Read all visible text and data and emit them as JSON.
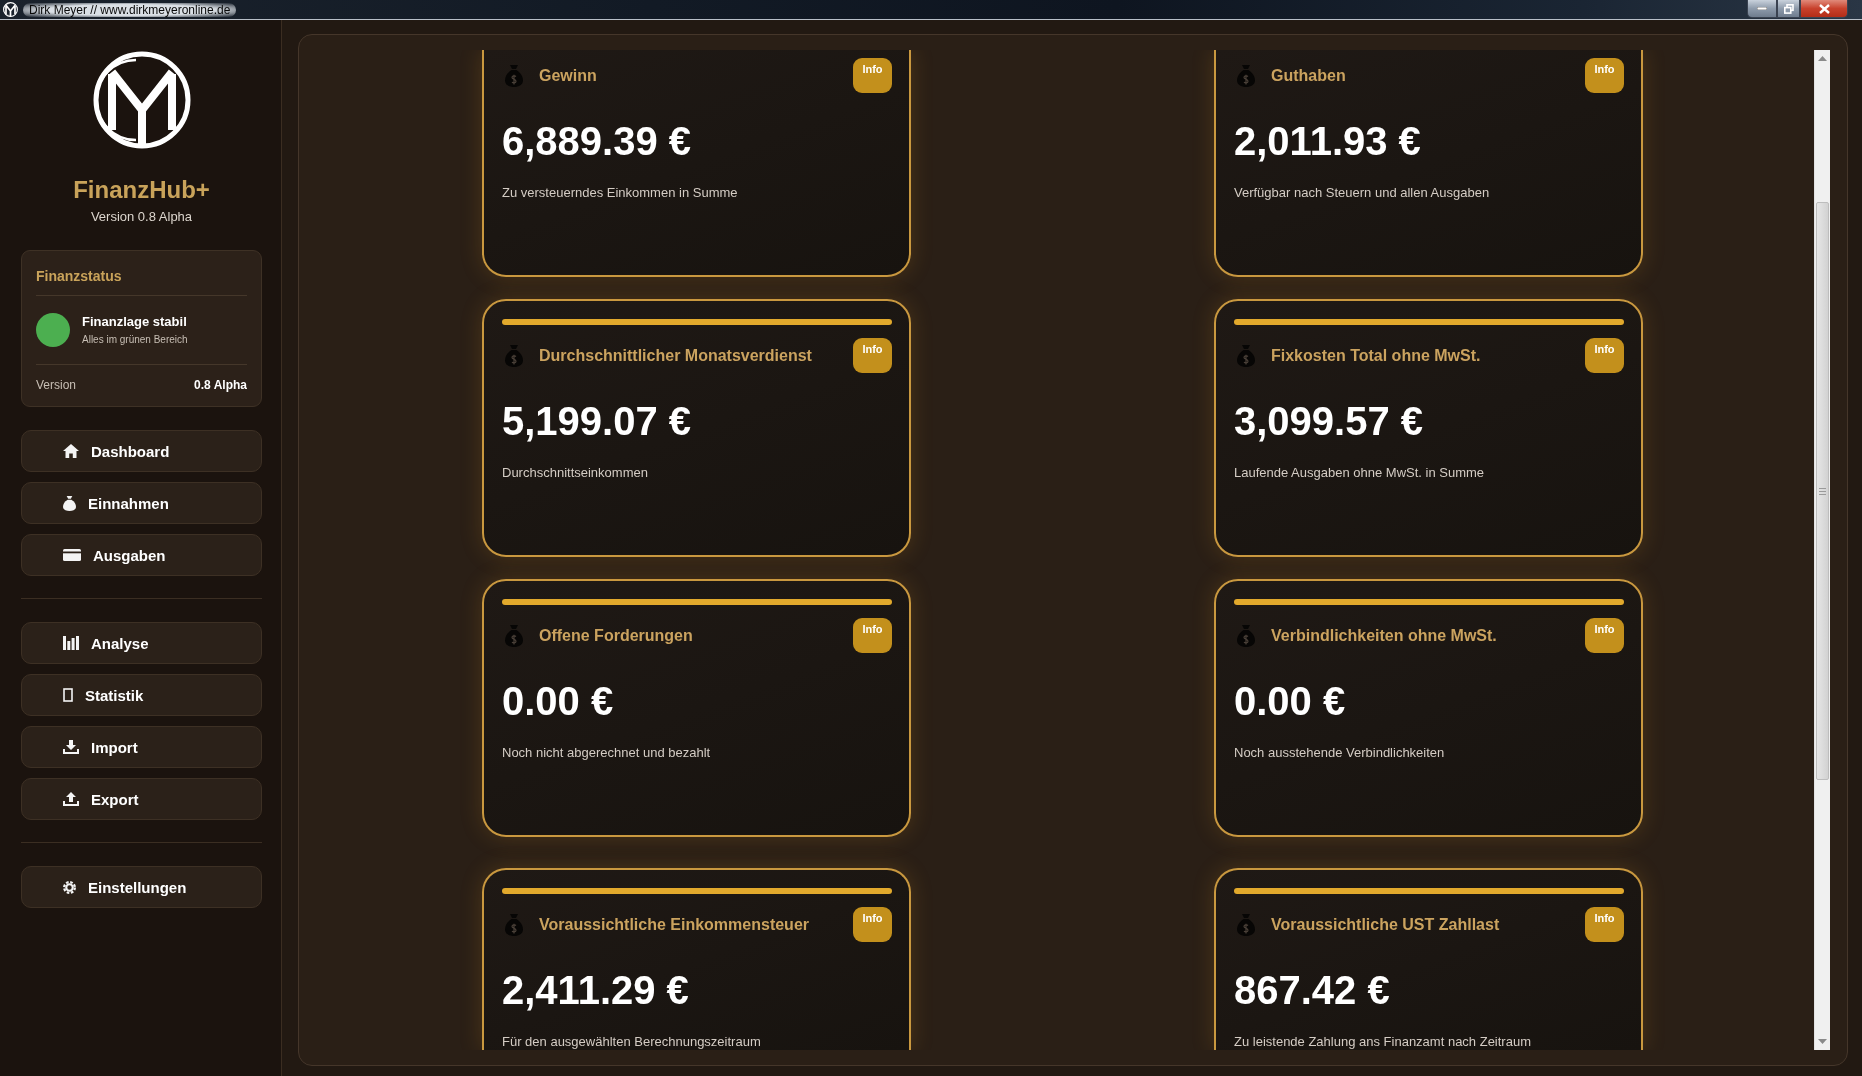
{
  "window": {
    "title": "Dirk Meyer // www.dirkmeyeronline.de"
  },
  "sidebar": {
    "app_name": "FinanzHub+",
    "version": "Version 0.8 Alpha",
    "status_card": {
      "title": "Finanzstatus",
      "status": {
        "label": "Finanzlage stabil",
        "detail": "Alles im grünen Bereich",
        "color": "#4caf50"
      },
      "version_label": "Version",
      "version_value": "0.8 Alpha"
    },
    "nav_groups": [
      {
        "items": [
          {
            "label": "Dashboard",
            "selected": false
          },
          {
            "label": "Einnahmen",
            "selected": false
          },
          {
            "label": "Ausgaben",
            "selected": false
          }
        ]
      },
      {
        "items": [
          {
            "label": "Analyse",
            "selected": false
          },
          {
            "label": "Statistik",
            "selected": false
          },
          {
            "label": "Import",
            "selected": false
          },
          {
            "label": "Export",
            "selected": false
          }
        ]
      },
      {
        "items": [
          {
            "label": "Einstellungen",
            "selected": false
          }
        ]
      }
    ]
  },
  "main": {
    "cards": [
      {
        "title": "Gewinn",
        "value": "6,889.39 €",
        "description": "Zu versteuerndes Einkommen in Summe",
        "info_button": "Info"
      },
      {
        "title": "Guthaben",
        "value": "2,011.93 €",
        "description": "Verfügbar nach Steuern und allen Ausgaben",
        "info_button": "Info"
      },
      {
        "title": "Durchschnittlicher Monatsverdienst",
        "value": "5,199.07 €",
        "description": "Durchschnittseinkommen",
        "info_button": "Info"
      },
      {
        "title": "Fixkosten Total ohne MwSt.",
        "value": "3,099.57 €",
        "description": "Laufende Ausgaben ohne MwSt. in Summe",
        "info_button": "Info"
      },
      {
        "title": "Offene Forderungen",
        "value": "0.00 €",
        "description": "Noch nicht abgerechnet und bezahlt",
        "info_button": "Info"
      },
      {
        "title": "Verbindlichkeiten ohne MwSt.",
        "value": "0.00 €",
        "description": "Noch ausstehende Verbindlichkeiten",
        "info_button": "Info"
      },
      {
        "title": "Voraussichtliche Einkommensteuer",
        "value": "2,411.29 €",
        "description": "Für den ausgewählten Berechnungszeitraum",
        "info_button": "Info"
      },
      {
        "title": "Voraussichtliche UST Zahllast",
        "value": "867.42 €",
        "description": "Zu leistende Zahlung ans Finanzamt nach Zeitraum",
        "info_button": "Info"
      }
    ]
  }
}
